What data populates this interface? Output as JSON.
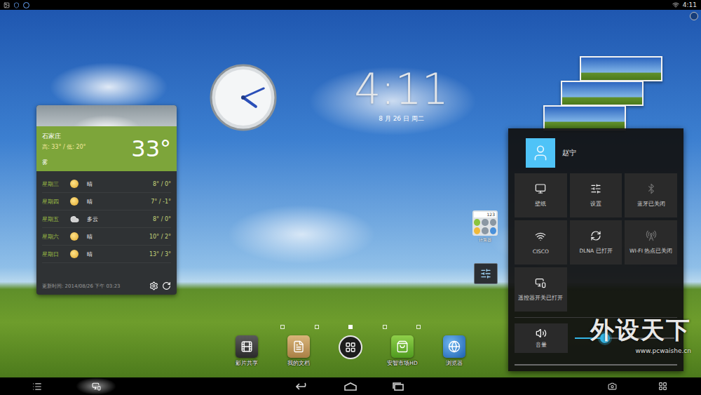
{
  "status_bar": {
    "time": "4:11"
  },
  "clock": {
    "time": "4:11",
    "date": "8 月 26 日 周二"
  },
  "weather": {
    "city": "石家庄",
    "high_low": "高: 33° / 低: 20°",
    "temperature": "33°",
    "condition": "雾",
    "forecast": [
      {
        "day": "星期三",
        "condition": "晴",
        "range": "8° / 0°",
        "kind": "sunny"
      },
      {
        "day": "星期四",
        "condition": "晴",
        "range": "7° / -1°",
        "kind": "sunny"
      },
      {
        "day": "星期五",
        "condition": "多云",
        "range": "8° / 0°",
        "kind": "cloudy"
      },
      {
        "day": "星期六",
        "condition": "晴",
        "range": "10° / 2°",
        "kind": "sunny"
      },
      {
        "day": "星期日",
        "condition": "晴",
        "range": "13° / 3°",
        "kind": "sunny"
      }
    ],
    "updated": "更新时间: 2014/08/26 下午 03:23"
  },
  "calculator_widget": {
    "display": "123",
    "label": "计算器"
  },
  "quick_settings": {
    "user": "赵宁",
    "tiles": [
      {
        "label": "壁纸",
        "on": true,
        "kind": "wallpaper"
      },
      {
        "label": "设置",
        "on": true,
        "kind": "settings"
      },
      {
        "label": "蓝牙已关闭",
        "on": false,
        "kind": "bluetooth"
      },
      {
        "label": "CISCO",
        "on": true,
        "kind": "wifi"
      },
      {
        "label": "DLNA 已打开",
        "on": true,
        "kind": "dlna"
      },
      {
        "label": "WI-FI 热点已关闭",
        "on": false,
        "kind": "hotspot"
      },
      {
        "label": "遥控器开关已打开",
        "on": true,
        "kind": "remote"
      }
    ],
    "volume": {
      "label": "音量",
      "level": 0.3
    }
  },
  "page_indicator": [
    {
      "selected": false
    },
    {
      "selected": false
    },
    {
      "selected": true
    },
    {
      "selected": false
    },
    {
      "selected": false
    }
  ],
  "dock": {
    "left": [
      {
        "label": "影片共享",
        "kind": "film"
      },
      {
        "label": "我的文档",
        "kind": "docs"
      }
    ],
    "right": [
      {
        "label": "安智市场HD",
        "kind": "market"
      },
      {
        "label": "浏览器",
        "kind": "browser"
      }
    ]
  },
  "watermark": {
    "title": "外设天下",
    "url": "www.pcwaishe.cn"
  }
}
